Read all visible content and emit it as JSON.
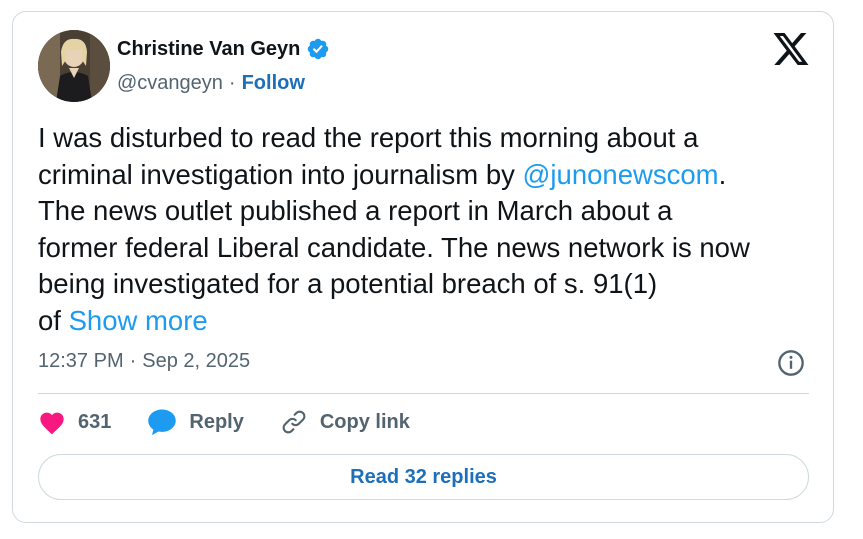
{
  "author": {
    "name": "Christine Van Geyn",
    "handle": "@cvangeyn",
    "separator": "·",
    "follow_label": "Follow"
  },
  "tweet": {
    "text_part1": "I was disturbed to read the report this morning about a\ncriminal investigation into journalism by ",
    "mention": "@junonewscom",
    "text_part2": ".\nThe news outlet published a report in March about a\nformer federal Liberal candidate. The news network is now\nbeing investigated for a potential breach of s. 91(1)\nof ",
    "show_more_label": "Show more"
  },
  "meta": {
    "time": "12:37 PM",
    "separator": "·",
    "date": "Sep 2, 2025"
  },
  "actions": {
    "like_count": "631",
    "reply_label": "Reply",
    "copy_link_label": "Copy link"
  },
  "read_replies_label": "Read 32 replies",
  "colors": {
    "accent": "#1d9bf0",
    "like": "#f91880",
    "verified": "#1d9bf0",
    "border": "#cfd9de"
  },
  "icons": {
    "verified": "verified-badge-icon",
    "logo": "x-logo-icon",
    "info": "info-icon",
    "like": "heart-icon",
    "reply": "speech-bubble-icon",
    "copy_link": "link-icon"
  }
}
